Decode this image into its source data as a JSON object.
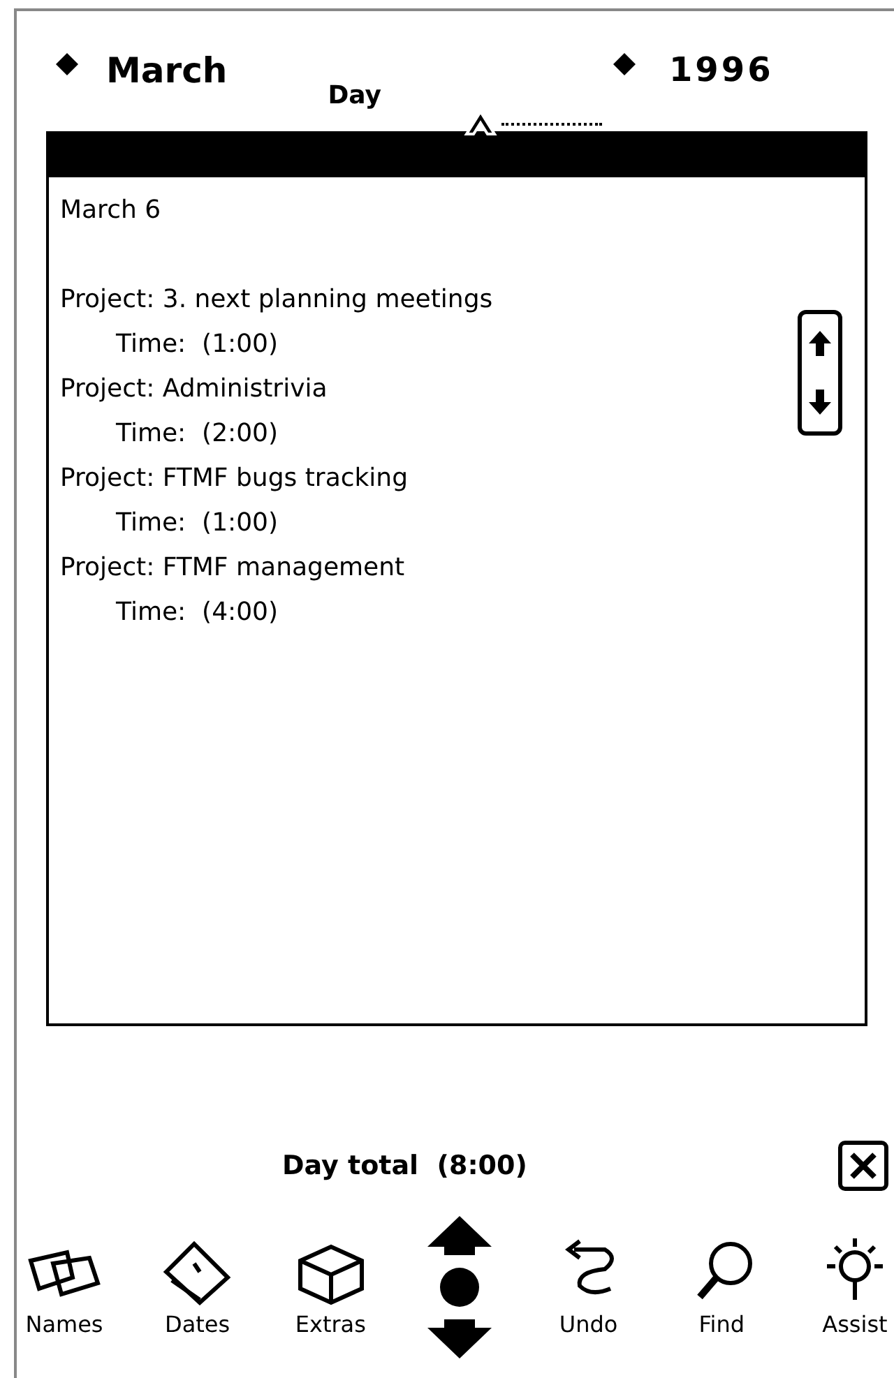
{
  "header": {
    "month": "March",
    "view": "Day",
    "year": "1996"
  },
  "date": "March 6",
  "entries": [
    {
      "project": "Project: 3. next planning meetings",
      "time": "Time:  (1:00)"
    },
    {
      "project": "Project: Administrivia",
      "time": "Time:  (2:00)"
    },
    {
      "project": "Project: FTMF bugs tracking",
      "time": "Time:  (1:00)"
    },
    {
      "project": "Project: FTMF management",
      "time": "Time:  (4:00)"
    }
  ],
  "day_total": "Day total  (8:00)",
  "buttons": [
    {
      "kind": "names",
      "label": "Names"
    },
    {
      "kind": "dates",
      "label": "Dates"
    },
    {
      "kind": "extras",
      "label": "Extras"
    },
    {
      "kind": "scroll"
    },
    {
      "kind": "undo",
      "label": "Undo"
    },
    {
      "kind": "find",
      "label": "Find"
    },
    {
      "kind": "assist",
      "label": "Assist"
    }
  ]
}
